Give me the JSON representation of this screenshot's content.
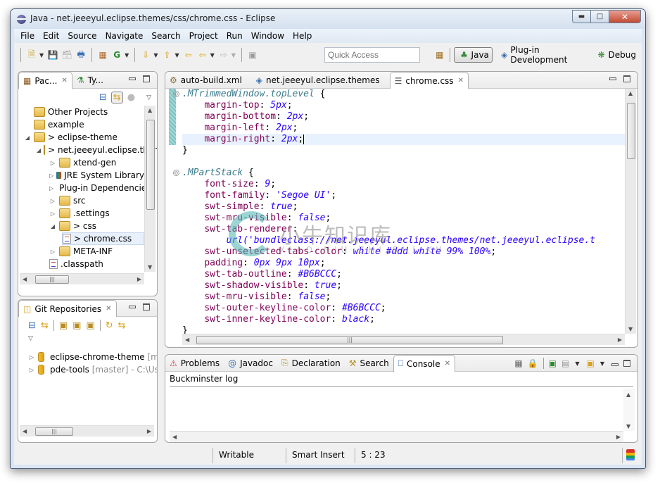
{
  "window": {
    "title": "Java - net.jeeeyul.eclipse.themes/css/chrome.css - Eclipse",
    "controls": {
      "minimize": "minimize-icon",
      "maximize": "maximize-icon",
      "close": "close-icon"
    }
  },
  "menubar": {
    "items": [
      "File",
      "Edit",
      "Source",
      "Navigate",
      "Search",
      "Project",
      "Run",
      "Window",
      "Help"
    ]
  },
  "toolbar": {
    "icons": [
      "new-icon",
      "save-icon",
      "save-all-icon",
      "print-icon",
      "new-java-package-icon",
      "new-class-icon",
      "next-annotation-icon",
      "previous-annotation-icon",
      "last-edit-location-icon",
      "back-icon",
      "forward-icon",
      "pin-editor-icon"
    ],
    "quick_access_placeholder": "Quick Access",
    "perspectives": [
      {
        "label": "Java",
        "active": true,
        "icon": "java-perspective-icon"
      },
      {
        "label": "Plug-in Development",
        "active": false,
        "icon": "plugin-perspective-icon"
      },
      {
        "label": "Debug",
        "active": false,
        "icon": "debug-perspective-icon"
      }
    ]
  },
  "package_explorer": {
    "tabs": [
      {
        "label": "Pac...",
        "active": true,
        "closable": true
      },
      {
        "label": "Ty...",
        "active": false
      }
    ],
    "tree": [
      {
        "label": "Other Projects",
        "depth": 0,
        "twist": "",
        "icon": "project"
      },
      {
        "label": "example",
        "depth": 0,
        "twist": "",
        "icon": "project"
      },
      {
        "label": "> eclipse-theme",
        "depth": 0,
        "twist": "expanded",
        "icon": "project"
      },
      {
        "label": "> net.jeeeyul.eclipse.themes",
        "depth": 1,
        "twist": "expanded",
        "icon": "plugin-project"
      },
      {
        "label": "xtend-gen",
        "depth": 2,
        "twist": "collapsed",
        "icon": "source-folder"
      },
      {
        "label": "JRE System Library",
        "depth": 2,
        "twist": "collapsed",
        "icon": "library"
      },
      {
        "label": "Plug-in Dependencies",
        "depth": 2,
        "twist": "collapsed",
        "icon": "library"
      },
      {
        "label": "src",
        "depth": 2,
        "twist": "collapsed",
        "icon": "source-folder"
      },
      {
        "label": ".settings",
        "depth": 2,
        "twist": "collapsed",
        "icon": "folder"
      },
      {
        "label": "> css",
        "depth": 2,
        "twist": "expanded",
        "icon": "folder"
      },
      {
        "label": "> chrome.css",
        "depth": 3,
        "twist": "",
        "icon": "css-file",
        "selected": true
      },
      {
        "label": "META-INF",
        "depth": 2,
        "twist": "collapsed",
        "icon": "folder"
      },
      {
        "label": ".classpath",
        "depth": 2,
        "twist": "",
        "icon": "classpath-file"
      }
    ]
  },
  "git_repositories": {
    "tab_label": "Git Repositories",
    "repos": [
      {
        "name": "eclipse-chrome-theme",
        "detail": "[master]"
      },
      {
        "name": "pde-tools",
        "detail": "[master] - C:\\Users"
      }
    ]
  },
  "editor": {
    "tabs": [
      {
        "label": "auto-build.xml",
        "active": false,
        "icon": "ant-file-icon"
      },
      {
        "label": "net.jeeeyul.eclipse.themes",
        "active": false,
        "icon": "plugin-manifest-icon"
      },
      {
        "label": "chrome.css",
        "active": true,
        "icon": "css-file-icon",
        "closable": true
      }
    ],
    "lines": [
      {
        "type": "selector",
        "text": ".MTrimmedWindow.topLevel",
        "fold": true
      },
      {
        "type": "decl",
        "prop": "margin-top",
        "val": "5px"
      },
      {
        "type": "decl",
        "prop": "margin-bottom",
        "val": "2px"
      },
      {
        "type": "decl",
        "prop": "margin-left",
        "val": "2px"
      },
      {
        "type": "decl",
        "prop": "margin-right",
        "val": "2px",
        "current": true
      },
      {
        "type": "close"
      },
      {
        "type": "blank"
      },
      {
        "type": "selector",
        "text": ".MPartStack",
        "fold": true
      },
      {
        "type": "decl",
        "prop": "font-size",
        "val": "9"
      },
      {
        "type": "decl",
        "prop": "font-family",
        "val": "'Segoe UI'"
      },
      {
        "type": "decl",
        "prop": "swt-simple",
        "val": "true"
      },
      {
        "type": "decl",
        "prop": "swt-mru-visible",
        "val": "false"
      },
      {
        "type": "propopen",
        "prop": "swt-tab-renderer"
      },
      {
        "type": "cont",
        "val": "url('bundleclass://net.jeeeyul.eclipse.themes/net.jeeeyul.eclipse.t"
      },
      {
        "type": "decl",
        "prop": "swt-unselected-tabs-color",
        "val": "white #ddd white 99% 100%"
      },
      {
        "type": "decl",
        "prop": "padding",
        "val": "0px 9px 10px"
      },
      {
        "type": "decl",
        "prop": "swt-tab-outline",
        "val": "#B6BCCC"
      },
      {
        "type": "decl",
        "prop": "swt-shadow-visible",
        "val": "true"
      },
      {
        "type": "decl",
        "prop": "swt-mru-visible",
        "val": "false"
      },
      {
        "type": "decl",
        "prop": "swt-outer-keyline-color",
        "val": "#B6BCCC"
      },
      {
        "type": "decl",
        "prop": "swt-inner-keyline-color",
        "val": "black"
      },
      {
        "type": "close"
      }
    ]
  },
  "bottom_panel": {
    "tabs": [
      {
        "label": "Problems",
        "active": false,
        "icon": "problems-icon"
      },
      {
        "label": "Javadoc",
        "active": false,
        "icon": "javadoc-icon"
      },
      {
        "label": "Declaration",
        "active": false,
        "icon": "declaration-icon"
      },
      {
        "label": "Search",
        "active": false,
        "icon": "search-icon"
      },
      {
        "label": "Console",
        "active": true,
        "icon": "console-icon",
        "closable": true
      }
    ],
    "console_title": "Buckminster log"
  },
  "statusbar": {
    "writable": "Writable",
    "insert_mode": "Smart Insert",
    "position": "5 : 23"
  },
  "watermark": {
    "text": "小牛知识库",
    "subtext": "XIAO NIU ZHI SHI KU"
  },
  "colors": {
    "css_property": "#7f0055",
    "css_value": "#2a00ff",
    "css_selector": "#3a7a8a",
    "current_line": "#e8f2fe"
  }
}
